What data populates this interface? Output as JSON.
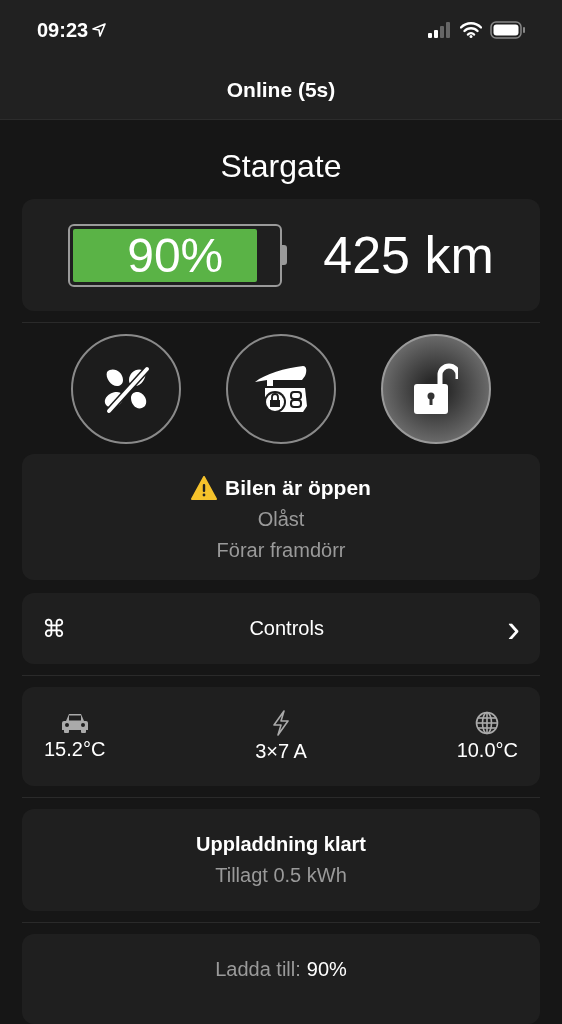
{
  "status_bar": {
    "time": "09:23"
  },
  "nav": {
    "title": "Online (5s)"
  },
  "vehicle": {
    "name": "Stargate",
    "battery": {
      "level": 0.9,
      "percent": "90%"
    },
    "range": "425 km"
  },
  "actions": [
    {
      "kind": "fan",
      "on": false
    },
    {
      "kind": "frunk",
      "on": false
    },
    {
      "kind": "lock",
      "on": true
    }
  ],
  "alert": {
    "title": "Bilen är öppen",
    "lines": [
      "Olåst",
      "Förar framdörr"
    ]
  },
  "controls": {
    "symbol": "⌘",
    "label": "Controls",
    "chevron": "›"
  },
  "readings": [
    {
      "kind": "car",
      "value": "15.2°C"
    },
    {
      "kind": "power",
      "value": "3×7 A"
    },
    {
      "kind": "globe",
      "value": "10.0°C"
    }
  ],
  "charging": {
    "title": "Uppladdning klart",
    "detail": "Tillagt 0.5 kWh"
  },
  "charge_limit": {
    "label": "Ladda till:",
    "value": "90%"
  }
}
